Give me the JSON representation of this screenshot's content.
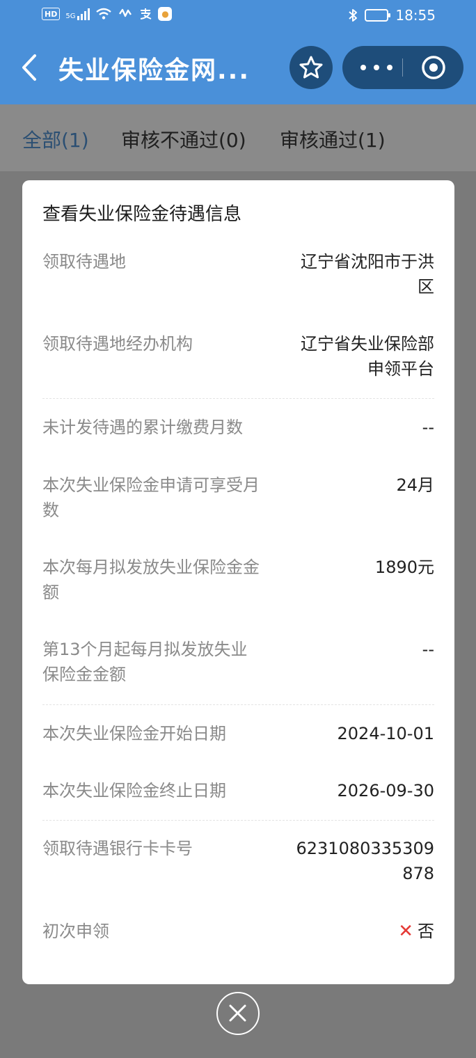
{
  "status_bar": {
    "chip_label": "HD",
    "network": "5G",
    "time": "18:55",
    "icons": [
      "hd-icon",
      "signal-icon",
      "wifi-icon",
      "vibrate-icon",
      "alipay-icon",
      "app-icon",
      "bluetooth-icon",
      "battery-icon"
    ]
  },
  "nav": {
    "title": "失业保险金网...",
    "star_icon": "star-icon",
    "more_icon": "more-icon",
    "close_icon": "target-icon"
  },
  "tabs": [
    {
      "label": "全部(1)",
      "active": true
    },
    {
      "label": "审核不通过(0)",
      "active": false
    },
    {
      "label": "审核通过(1)",
      "active": false
    }
  ],
  "card": {
    "title": "查看失业保险金待遇信息",
    "rows": [
      {
        "label": "领取待遇地",
        "value": "辽宁省沈阳市于洪区"
      },
      {
        "label": "领取待遇地经办机构",
        "value": "辽宁省失业保险部申领平台"
      },
      {
        "label": "未计发待遇的累计缴费月数",
        "value": "--"
      },
      {
        "label": "本次失业保险金申请可享受月数",
        "value": "24月"
      },
      {
        "label": "本次每月拟发放失业保险金金额",
        "value": "1890元"
      },
      {
        "label": "第13个月起每月拟发放失业保险金金额",
        "value": "--"
      },
      {
        "label": "本次失业保险金开始日期",
        "value": "2024-10-01"
      },
      {
        "label": "本次失业保险金终止日期",
        "value": "2026-09-30"
      },
      {
        "label": "领取待遇银行卡卡号",
        "value": "6231080335309878"
      },
      {
        "label": "初次申领",
        "value": "否",
        "mark": "✕"
      }
    ]
  },
  "colors": {
    "header_blue": "#4a90d9",
    "capsule_dark": "#1e4d7a",
    "active_tab": "#2b4f73",
    "reject_red": "#e53935"
  }
}
